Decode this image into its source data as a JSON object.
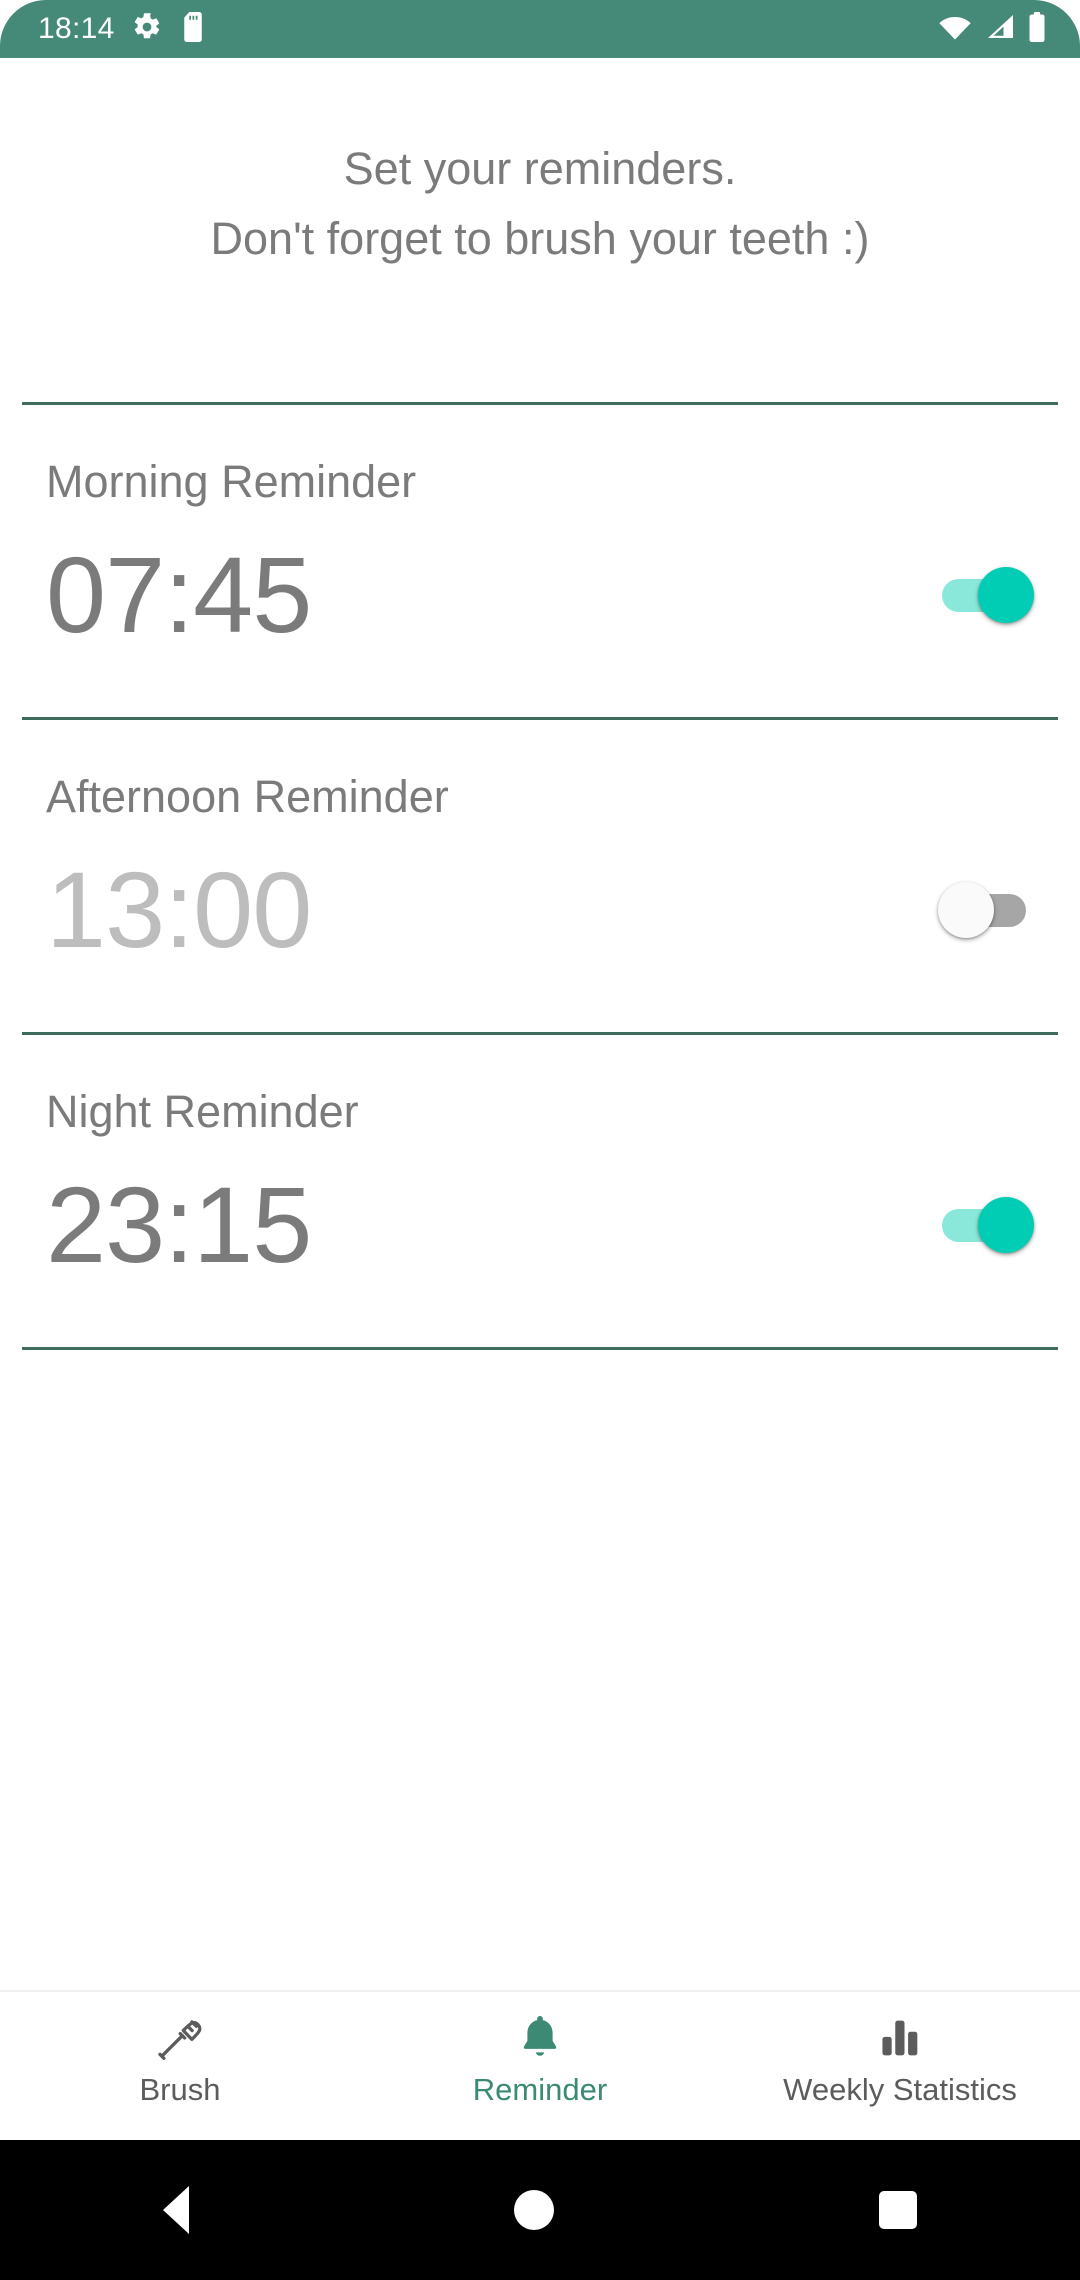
{
  "status_bar": {
    "time": "18:14",
    "left_icons": [
      "gear-icon",
      "sd-card-icon"
    ],
    "right_icons": [
      "wifi-icon",
      "cell-signal-icon",
      "battery-icon"
    ],
    "background_color": "#458a78"
  },
  "header": {
    "line1": "Set your reminders.",
    "line2": "Don't forget to brush your teeth :)"
  },
  "reminders": [
    {
      "label": "Morning Reminder",
      "time": "07:45",
      "enabled": true,
      "switch_state": "on"
    },
    {
      "label": "Afternoon Reminder",
      "time": "13:00",
      "enabled": false,
      "switch_state": "off"
    },
    {
      "label": "Night Reminder",
      "time": "23:15",
      "enabled": true,
      "switch_state": "on"
    }
  ],
  "bottom_nav": {
    "items": [
      {
        "label": "Brush",
        "icon": "toothbrush-icon",
        "active": false
      },
      {
        "label": "Reminder",
        "icon": "bell-icon",
        "active": true
      },
      {
        "label": "Weekly Statistics",
        "icon": "bar-chart-icon",
        "active": false
      }
    ],
    "active_color": "#3d8a74",
    "inactive_color": "#5c5c5c"
  },
  "system_nav": {
    "buttons": [
      "back-button",
      "home-button",
      "recents-button"
    ]
  },
  "colors": {
    "accent_teal": "#00cdb4",
    "track_teal": "#8ae8da",
    "divider_green": "#3d6b5e",
    "text_gray": "#7b7b7b",
    "text_gray_disabled": "#bdbdbd"
  }
}
